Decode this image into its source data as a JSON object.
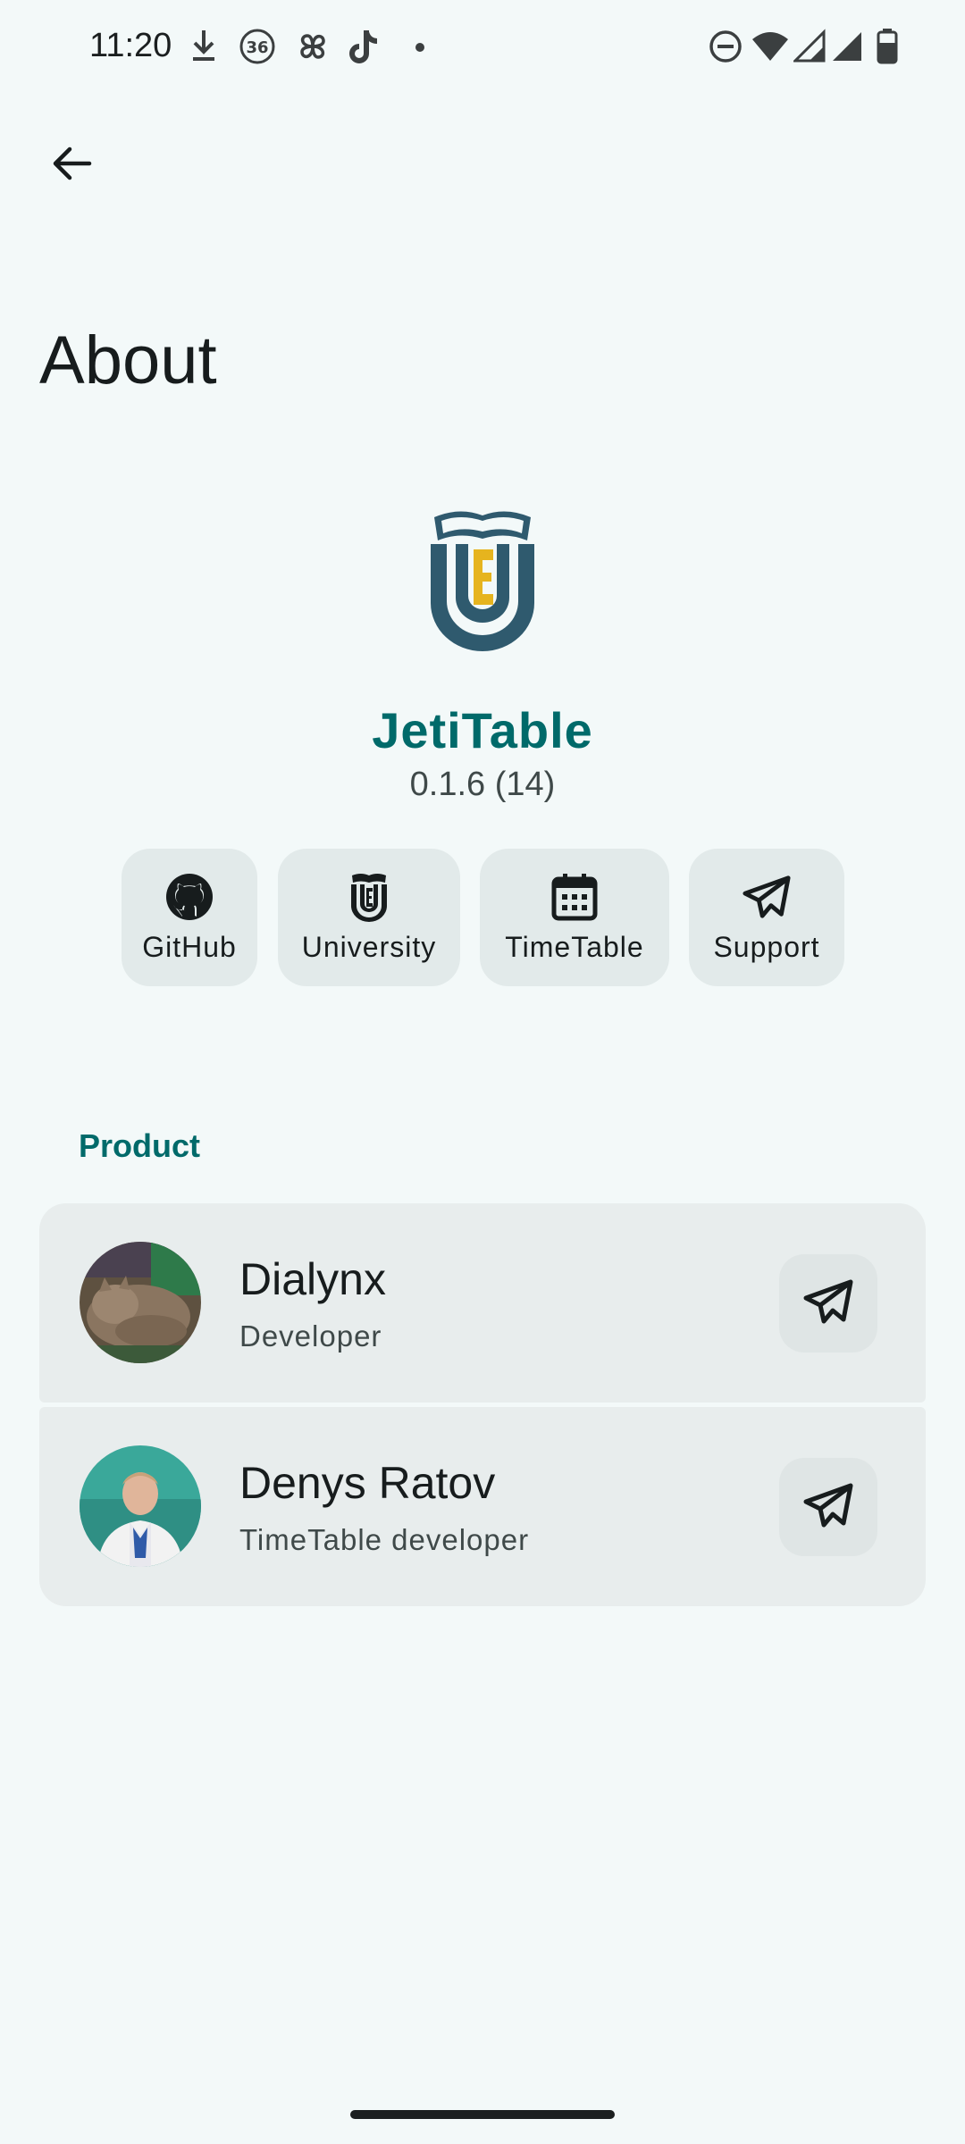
{
  "status_bar": {
    "time": "11:20",
    "left_icons": [
      "download-icon",
      "badge-36-icon",
      "pinwheel-icon",
      "tiktok-icon",
      "dot-icon"
    ],
    "badge_text": "36",
    "right_icons": [
      "do-not-disturb-icon",
      "wifi-icon",
      "signal-icon",
      "signal-icon",
      "battery-icon"
    ]
  },
  "app_bar": {
    "back_icon": "arrow-back-icon",
    "title": "About"
  },
  "header": {
    "app_name": "JetiTable",
    "version": "0.1.6 (14)",
    "logo_letter": "E",
    "colors": {
      "accent": "#006a6a",
      "logo_dark": "#2f5a6e",
      "logo_yellow": "#e6b41e"
    }
  },
  "links": [
    {
      "label": "GitHub",
      "icon": "github-icon"
    },
    {
      "label": "University",
      "icon": "university-icon"
    },
    {
      "label": "TimeTable",
      "icon": "calendar-icon"
    },
    {
      "label": "Support",
      "icon": "telegram-icon"
    }
  ],
  "section": {
    "title": "Product",
    "people": [
      {
        "name": "Dialynx",
        "role": "Developer",
        "avatar": "cat-photo",
        "action_icon": "telegram-icon"
      },
      {
        "name": "Denys Ratov",
        "role": "TimeTable developer",
        "avatar": "person-photo",
        "action_icon": "telegram-icon"
      }
    ]
  }
}
